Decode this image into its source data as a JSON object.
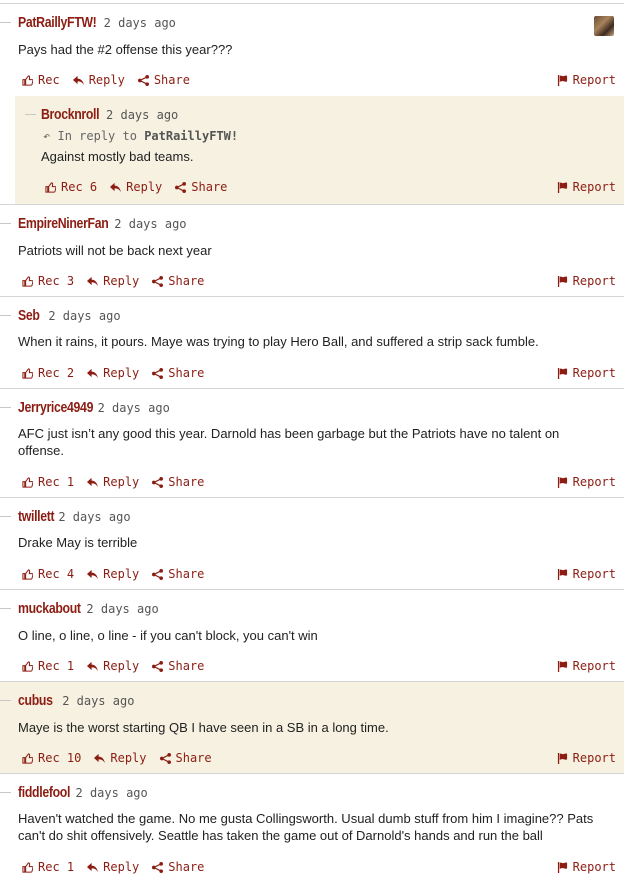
{
  "labels": {
    "rec": "Rec",
    "reply": "Reply",
    "share": "Share",
    "report": "Report",
    "in_reply_to": "In reply to"
  },
  "comments": [
    {
      "author": "PatRaillyFTW!",
      "time": "2 days ago",
      "body": "Pays had the #2 offense this year???",
      "rec": ""
    },
    {
      "author": "Brocknroll",
      "time": "2 days ago",
      "reply_to": "PatRaillyFTW!",
      "body": "Against mostly bad teams.",
      "rec": "6"
    },
    {
      "author": "EmpireNinerFan",
      "time": "2 days ago",
      "body": "Patriots will not be back next year",
      "rec": "3"
    },
    {
      "author": "Seb",
      "time": "2 days ago",
      "body": "When it rains, it pours. Maye was trying to play Hero Ball, and suffered a strip sack fumble.",
      "rec": "2"
    },
    {
      "author": "Jerryrice4949",
      "time": "2 days ago",
      "body": "AFC just isn’t any good this year. Darnold has been garbage but the Patriots have no talent on offense.",
      "rec": "1"
    },
    {
      "author": "twillett",
      "time": "2 days ago",
      "body": "Drake May is terrible",
      "rec": "4"
    },
    {
      "author": "muckabout",
      "time": "2 days ago",
      "body": "O line, o line, o line - if you can't block, you can't win",
      "rec": "1"
    },
    {
      "author": "cubus",
      "time": "2 days ago",
      "body": "Maye is the worst starting QB I have seen in a SB in a long time.",
      "rec": "10"
    },
    {
      "author": "fiddlefool",
      "time": "2 days ago",
      "body": "Haven't watched the game. No me gusta Collingsworth. Usual dumb stuff from him I imagine?? Pats can't do shit offensively. Seattle has taken the game out of Darnold's hands and run the ball",
      "rec": "1"
    }
  ]
}
